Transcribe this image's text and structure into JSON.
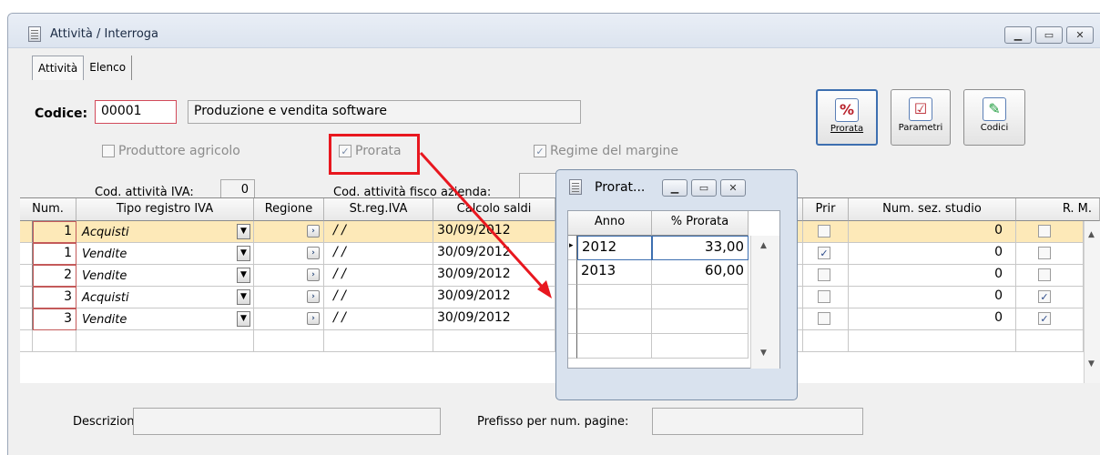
{
  "window": {
    "title": "Attività / Interroga",
    "controls": [
      "minimize-icon",
      "maximize-icon",
      "close-icon"
    ]
  },
  "tabs": [
    {
      "label": "Attività",
      "active": true
    },
    {
      "label": "Elenco",
      "active": false
    }
  ],
  "form": {
    "codice_label": "Codice:",
    "codice_value": "00001",
    "descrizione_value": "Produzione e vendita software",
    "produttore_agricolo": {
      "label": "Produttore agricolo",
      "checked": false
    },
    "prorata": {
      "label": "Prorata",
      "checked": true
    },
    "regime_margine": {
      "label": "Regime del margine",
      "checked": true
    },
    "cod_attivita_iva_label": "Cod. attività IVA:",
    "cod_attivita_iva_value": "0",
    "cod_attivita_fisco_label": "Cod. attività fisco azienda:"
  },
  "toolbar": [
    {
      "label": "Prorata",
      "icon": "percent-icon"
    },
    {
      "label": "Parametri",
      "icon": "checklist-icon"
    },
    {
      "label": "Codici",
      "icon": "pencil-icon"
    }
  ],
  "grid": {
    "headers": [
      "Num.",
      "Tipo registro IVA",
      "Regione",
      "St.reg.IVA",
      "Calcolo saldi",
      "Prir",
      "Num. sez. studio",
      "R. M."
    ],
    "rows": [
      {
        "num": "1",
        "tipo": "Acquisti",
        "streg": "/ /",
        "calcolo": "30/09/2012",
        "prir": false,
        "sez": "0",
        "rm": false
      },
      {
        "num": "1",
        "tipo": "Vendite",
        "streg": "/ /",
        "calcolo": "30/09/2012",
        "prir": true,
        "sez": "0",
        "rm": false
      },
      {
        "num": "2",
        "tipo": "Vendite",
        "streg": "/ /",
        "calcolo": "30/09/2012",
        "prir": false,
        "sez": "0",
        "rm": false
      },
      {
        "num": "3",
        "tipo": "Acquisti",
        "streg": "/ /",
        "calcolo": "30/09/2012",
        "prir": false,
        "sez": "0",
        "rm": true
      },
      {
        "num": "3",
        "tipo": "Vendite",
        "streg": "/ /",
        "calcolo": "30/09/2012",
        "prir": false,
        "sez": "0",
        "rm": true
      }
    ]
  },
  "footer": {
    "descrizione_label": "Descrizione:",
    "prefisso_label": "Prefisso per num. pagine:"
  },
  "popup": {
    "title": "Prorat...",
    "headers": [
      "Anno",
      "% Prorata"
    ],
    "rows": [
      {
        "anno": "2012",
        "prorata": "33,00"
      },
      {
        "anno": "2013",
        "prorata": "60,00"
      }
    ]
  },
  "annotation_color": "#e8171f"
}
